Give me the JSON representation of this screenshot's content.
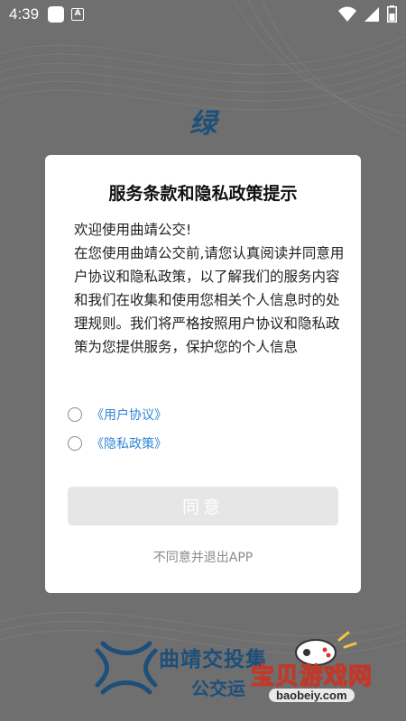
{
  "status_bar": {
    "time": "4:39",
    "icons": [
      "notification-square-icon",
      "a-badge-icon",
      "wifi-icon",
      "cellular-signal-icon",
      "battery-icon"
    ],
    "badge_letter": "A"
  },
  "background": {
    "brand_char": "绿"
  },
  "dialog": {
    "title": "服务条款和隐私政策提示",
    "body_lines": [
      "欢迎使用曲靖公交!",
      "在您使用曲靖公交前,请您认真阅读并同意用户协议和隐私政策，以了解我们的服务内容和我们在收集和使用您相关个人信息时的处理规则。我们将严格按照用户协议和隐私政策为您提供服务，保护您的个人信息"
    ],
    "user_agreement_link": "《用户协议》",
    "privacy_policy_link": "《隐私政策》",
    "agree_button": "同意",
    "exit_link": "不同意并退出APP"
  },
  "footer": {
    "company_name": "曲靖交投集",
    "company_sub": "公交运",
    "watermark_text": "宝贝游戏网",
    "watermark_domain": "baobeiy.com"
  },
  "colors": {
    "overlay_bg": "#6f6f6f",
    "brand_blue": "#1d4f7a",
    "link_blue": "#2f86d6",
    "button_disabled": "#e6e6e6"
  }
}
